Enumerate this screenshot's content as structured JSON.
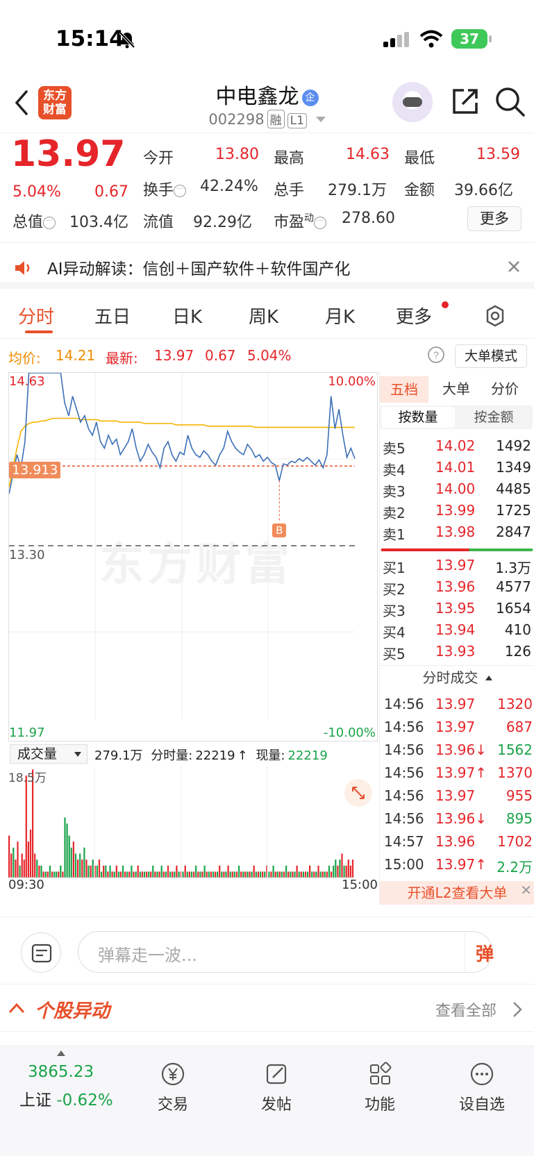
{
  "status": {
    "time": "15:14",
    "battery": "37"
  },
  "header": {
    "logo_text": "东方财富",
    "stock_name": "中电鑫龙",
    "verify_badge": "企",
    "stock_code": "002298",
    "tag_margin": "融",
    "tag_level": "L1"
  },
  "quote": {
    "last": "13.97",
    "change_pct": "5.04%",
    "change": "0.67",
    "open_label": "今开",
    "open": "13.80",
    "high_label": "最高",
    "high": "14.63",
    "low_label": "最低",
    "low": "13.59",
    "turnover_label": "换手",
    "turnover": "42.24%",
    "volume_label": "总手",
    "volume": "279.1万",
    "amount_label": "金额",
    "amount": "39.66亿",
    "mktcap_label": "总值",
    "mktcap": "103.4亿",
    "float_label": "流值",
    "float": "92.29亿",
    "pe_label": "市盈",
    "pe_sup": "动",
    "pe": "278.60",
    "more": "更多"
  },
  "ai_banner": {
    "text": "AI异动解读：信创＋国产软件＋软件国产化"
  },
  "tabs": [
    "分时",
    "五日",
    "日K",
    "周K",
    "月K",
    "更多"
  ],
  "chart_info": {
    "avg_label": "均价:",
    "avg": "14.21",
    "latest_label": "最新:",
    "latest": "13.97",
    "chg": "0.67",
    "pct": "5.04%",
    "mode_button": "大单模式"
  },
  "chart_data": {
    "type": "line",
    "y_high_label": "14.63",
    "y_prev_close_label": "13.30",
    "y_low_label": "11.97",
    "pct_high_label": "10.00%",
    "pct_low_label": "-10.00%",
    "crosshair_label": "13.913",
    "marker": "B",
    "ylim": [
      11.97,
      14.63
    ],
    "prev_close": 13.3,
    "crosshair": 13.913,
    "price_series": [
      13.7,
      13.85,
      14.0,
      13.9,
      14.1,
      14.63,
      14.63,
      14.63,
      14.63,
      14.63,
      14.63,
      14.63,
      14.63,
      14.63,
      14.4,
      14.3,
      14.45,
      14.35,
      14.25,
      14.3,
      14.2,
      14.15,
      14.25,
      14.1,
      14.05,
      14.15,
      14.08,
      14.12,
      14.0,
      14.05,
      14.1,
      14.2,
      14.05,
      13.95,
      14.0,
      14.08,
      14.02,
      13.98,
      13.9,
      14.05,
      14.1,
      14.0,
      13.95,
      14.02,
      14.0,
      14.15,
      14.05,
      14.0,
      13.98,
      14.03,
      14.0,
      13.95,
      13.92,
      14.0,
      14.05,
      14.18,
      14.1,
      14.05,
      14.02,
      14.0,
      14.08,
      14.04,
      13.98,
      14.0,
      13.95,
      13.98,
      13.94,
      13.92,
      13.8,
      13.93,
      13.92,
      13.95,
      13.94,
      13.97,
      13.95,
      13.98,
      13.95,
      13.92,
      13.96,
      13.9,
      14.0,
      14.45,
      14.2,
      14.35,
      14.15,
      13.98,
      14.05,
      13.97
    ],
    "avg_series": [
      13.75,
      13.9,
      14.05,
      14.18,
      14.22,
      14.24,
      14.25,
      14.25,
      14.26,
      14.26,
      14.27,
      14.28,
      14.28,
      14.28,
      14.28,
      14.28,
      14.28,
      14.28,
      14.27,
      14.27,
      14.27,
      14.27,
      14.27,
      14.26,
      14.26,
      14.26,
      14.26,
      14.26,
      14.25,
      14.25,
      14.25,
      14.25,
      14.25,
      14.25,
      14.24,
      14.24,
      14.24,
      14.24,
      14.24,
      14.24,
      14.24,
      14.24,
      14.23,
      14.23,
      14.23,
      14.23,
      14.23,
      14.23,
      14.23,
      14.23,
      14.22,
      14.22,
      14.22,
      14.22,
      14.22,
      14.22,
      14.22,
      14.22,
      14.22,
      14.22,
      14.22,
      14.22,
      14.21,
      14.21,
      14.21,
      14.21,
      14.21,
      14.21,
      14.21,
      14.21,
      14.21,
      14.21,
      14.21,
      14.21,
      14.21,
      14.21,
      14.21,
      14.21,
      14.21,
      14.21,
      14.21,
      14.21,
      14.21,
      14.21,
      14.21,
      14.21,
      14.21,
      14.21
    ],
    "volume_label": "成交量",
    "volume_total": "279.1万",
    "bar_volume_label": "分时量:",
    "bar_volume": "22219",
    "cur_volume_label": "现量:",
    "cur_volume": "22219",
    "vol_max_label": "18.5万",
    "x_start": "09:30",
    "x_end": "15:00",
    "volumes": [
      7,
      4,
      5,
      3,
      6,
      2,
      4,
      3,
      17,
      6,
      8,
      18,
      4,
      3,
      2,
      2,
      1,
      1,
      1,
      2,
      1,
      1,
      1,
      1,
      2,
      1,
      10,
      9,
      7,
      5,
      6,
      4,
      3,
      4,
      3,
      5,
      3,
      2,
      2,
      3,
      2,
      2,
      3,
      1,
      2,
      2,
      1,
      2,
      1,
      1,
      2,
      1,
      1,
      2,
      1,
      1,
      1,
      2,
      1,
      1,
      2,
      1,
      1,
      1,
      1,
      1,
      1,
      2,
      1,
      1,
      1,
      2,
      1,
      1,
      2,
      1,
      1,
      1,
      2,
      1,
      1,
      1,
      2,
      1,
      1,
      1,
      1,
      2,
      1,
      1,
      1,
      2,
      1,
      1,
      1,
      1,
      1,
      1,
      2,
      1,
      1,
      1,
      2,
      1,
      1,
      1,
      1,
      2,
      1,
      1,
      1,
      1,
      1,
      1,
      2,
      1,
      1,
      1,
      1,
      1,
      2,
      1,
      1,
      2,
      1,
      1,
      1,
      1,
      1,
      2,
      1,
      1,
      1,
      1,
      2,
      1,
      1,
      1,
      1,
      1,
      2,
      1,
      1,
      1,
      2,
      1,
      1,
      1,
      1,
      2,
      1,
      2,
      3,
      2,
      3,
      4,
      2,
      2,
      3,
      2,
      3
    ],
    "volume_colors": [
      "red",
      "red",
      "green",
      "red",
      "red",
      "green",
      "red",
      "red",
      "red",
      "red",
      "red",
      "red",
      "red",
      "green",
      "red",
      "green",
      "red",
      "green",
      "red",
      "green",
      "red",
      "green",
      "green",
      "red",
      "green",
      "red",
      "green",
      "green",
      "green",
      "green",
      "red",
      "green",
      "red",
      "green",
      "red",
      "green",
      "red",
      "green",
      "red",
      "green",
      "red",
      "green",
      "red",
      "green",
      "red",
      "green",
      "red",
      "green",
      "red",
      "green",
      "red",
      "green",
      "red",
      "green",
      "red",
      "green",
      "red",
      "green",
      "red",
      "green",
      "red",
      "green",
      "red",
      "green",
      "red",
      "green",
      "red",
      "green",
      "red",
      "green",
      "red",
      "green",
      "red",
      "green",
      "red",
      "green",
      "red",
      "green",
      "red",
      "green",
      "red",
      "green",
      "red",
      "green",
      "red",
      "green",
      "red",
      "green",
      "red",
      "green",
      "red",
      "green",
      "red",
      "green",
      "red",
      "green",
      "red",
      "green",
      "red",
      "green",
      "red",
      "green",
      "red",
      "green",
      "red",
      "green",
      "red",
      "green",
      "red",
      "green",
      "red",
      "green",
      "red",
      "green",
      "red",
      "green",
      "red",
      "green",
      "red",
      "green",
      "red",
      "green",
      "red",
      "green",
      "red",
      "green",
      "red",
      "green",
      "red",
      "green",
      "red",
      "green",
      "red",
      "green",
      "red",
      "green",
      "red",
      "green",
      "red",
      "green",
      "red",
      "green",
      "red",
      "green",
      "red",
      "green",
      "red",
      "green",
      "red",
      "green",
      "red",
      "green",
      "green",
      "red",
      "green",
      "red",
      "green",
      "red"
    ],
    "volume_max": 18.5
  },
  "book": {
    "tabs": [
      "五档",
      "大单",
      "分价"
    ],
    "seg_on": "按数量",
    "seg_off": "按金额",
    "asks": [
      {
        "label": "卖5",
        "price": "14.02",
        "vol": "1492"
      },
      {
        "label": "卖4",
        "price": "14.01",
        "vol": "1349"
      },
      {
        "label": "卖3",
        "price": "14.00",
        "vol": "4485"
      },
      {
        "label": "卖2",
        "price": "13.99",
        "vol": "1725"
      },
      {
        "label": "卖1",
        "price": "13.98",
        "vol": "2847"
      }
    ],
    "bids": [
      {
        "label": "买1",
        "price": "13.97",
        "vol": "1.3万"
      },
      {
        "label": "买2",
        "price": "13.96",
        "vol": "4577"
      },
      {
        "label": "买3",
        "price": "13.95",
        "vol": "1654"
      },
      {
        "label": "买4",
        "price": "13.94",
        "vol": "410"
      },
      {
        "label": "买5",
        "price": "13.93",
        "vol": "126"
      }
    ],
    "trades_title": "分时成交",
    "trades": [
      {
        "time": "14:56",
        "price": "13.97",
        "vol": "1320",
        "dir": "buy"
      },
      {
        "time": "14:56",
        "price": "13.97",
        "vol": "687",
        "dir": "buy"
      },
      {
        "time": "14:56",
        "price": "13.96↓",
        "vol": "1562",
        "dir": "sell"
      },
      {
        "time": "14:56",
        "price": "13.97↑",
        "vol": "1370",
        "dir": "buy"
      },
      {
        "time": "14:56",
        "price": "13.97",
        "vol": "955",
        "dir": "buy"
      },
      {
        "time": "14:56",
        "price": "13.96↓",
        "vol": "895",
        "dir": "sell"
      },
      {
        "time": "14:57",
        "price": "13.96",
        "vol": "1702",
        "dir": "buy"
      },
      {
        "time": "15:00",
        "price": "13.97↑",
        "vol": "2.2万",
        "dir": "sell"
      }
    ],
    "l2_banner": "开通L2查看大单"
  },
  "comment": {
    "placeholder": "弹幕走一波...",
    "send": "弹"
  },
  "movers": {
    "title": "个股异动",
    "more": "查看全部"
  },
  "bottom_nav": {
    "index_value": "3865.23",
    "index_name": "上证",
    "index_change": "-0.62%",
    "items": [
      "交易",
      "发帖",
      "功能",
      "设自选"
    ]
  },
  "colors": {
    "up": "#e5252a",
    "down": "#1aa34a",
    "accent": "#e8502a",
    "price_line": "#3b6fb6",
    "avg_line": "#f5b400"
  }
}
